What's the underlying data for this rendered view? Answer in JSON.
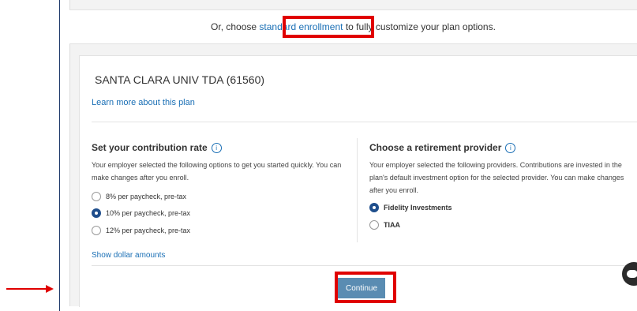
{
  "banner": {
    "prefix": "Or, choose",
    "link": "standard enrollment",
    "suffix": "to fully customize your plan options."
  },
  "plan": {
    "name": "SANTA CLARA UNIV TDA (61560)",
    "learn_more": "Learn more about this plan"
  },
  "contribution": {
    "title": "Set your contribution rate",
    "description": "Your employer selected the following options to get you started quickly. You can make changes after you enroll.",
    "options": [
      {
        "label": "8% per paycheck, pre-tax",
        "selected": false
      },
      {
        "label": "10% per paycheck, pre-tax",
        "selected": true
      },
      {
        "label": "12% per paycheck, pre-tax",
        "selected": false
      }
    ],
    "show_dollar": "Show dollar amounts"
  },
  "provider": {
    "title": "Choose a retirement provider",
    "description": "Your employer selected the following providers. Contributions are invested in the plan's default investment option for the selected provider. You can make changes after you enroll.",
    "options": [
      {
        "label": "Fidelity Investments",
        "selected": true
      },
      {
        "label": "TIAA",
        "selected": false
      }
    ]
  },
  "continue_label": "Continue",
  "icons": {
    "info": "info-icon",
    "chat": "chat-icon",
    "arrow": "arrow-right-icon"
  },
  "colors": {
    "link": "#1a6fb5",
    "accent": "#1f4e8c",
    "button": "#5a8cb2",
    "highlight": "#e00000"
  }
}
